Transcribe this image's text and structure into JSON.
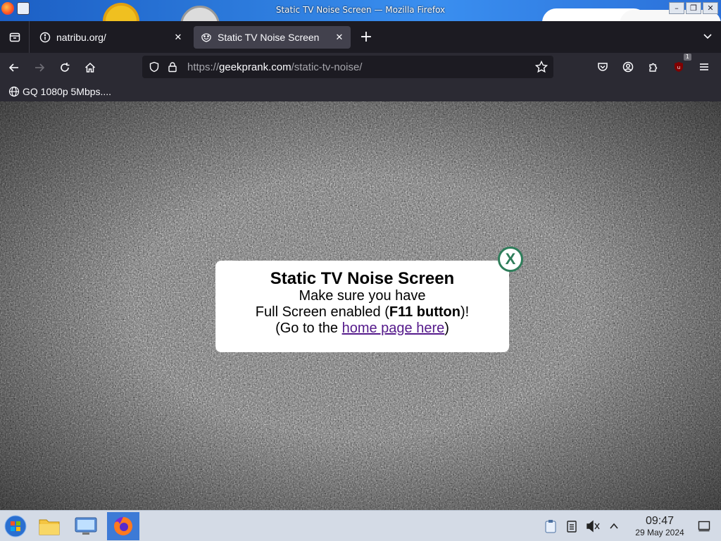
{
  "window": {
    "title": "Static TV Noise Screen — Mozilla Firefox",
    "controls": {
      "minimize": "–",
      "maximize": "❐",
      "close": "✕"
    }
  },
  "tabs": [
    {
      "label": "natribu.org/",
      "icon": "info-icon",
      "active": false
    },
    {
      "label": "Static TV Noise Screen",
      "icon": "troll-face-icon",
      "active": true
    }
  ],
  "tabstrip": {
    "new_tab": "+",
    "close_glyph": "✕"
  },
  "urlbar": {
    "scheme": "https://",
    "host": "geekprank.com",
    "path": "/static-tv-noise/"
  },
  "toolbar": {
    "extension_badge": "1"
  },
  "bookmarks": [
    {
      "label": "GQ 1080p 5Mbps...."
    }
  ],
  "modal": {
    "title": "Static TV Noise Screen",
    "line1": "Make sure you have",
    "line2_pre": "Full Screen enabled (",
    "line2_bold": "F11 button",
    "line2_post": ")!",
    "line3_pre": "(Go to the ",
    "line3_link": "home page here",
    "line3_post": ")",
    "close": "X"
  },
  "taskbar": {
    "time": "09:47",
    "date": "29 May 2024"
  },
  "colors": {
    "modal_close": "#2e7d5a",
    "link": "#551a8b",
    "taskbar_active": "#3d7ad6"
  }
}
